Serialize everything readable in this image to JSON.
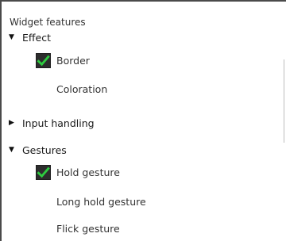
{
  "title": "Widget features",
  "groups": [
    {
      "label": "Effect",
      "expanded": true,
      "items": [
        {
          "label": "Border",
          "checked": true
        },
        {
          "label": "Coloration",
          "checked": false
        }
      ]
    },
    {
      "label": "Input handling",
      "expanded": false,
      "items": []
    },
    {
      "label": "Gestures",
      "expanded": true,
      "items": [
        {
          "label": "Hold gesture",
          "checked": true
        },
        {
          "label": "Long hold gesture",
          "checked": false
        },
        {
          "label": "Flick gesture",
          "checked": false
        }
      ]
    }
  ],
  "colors": {
    "check_bg": "#2d2d2d",
    "check_mark": "#2ecc40"
  }
}
